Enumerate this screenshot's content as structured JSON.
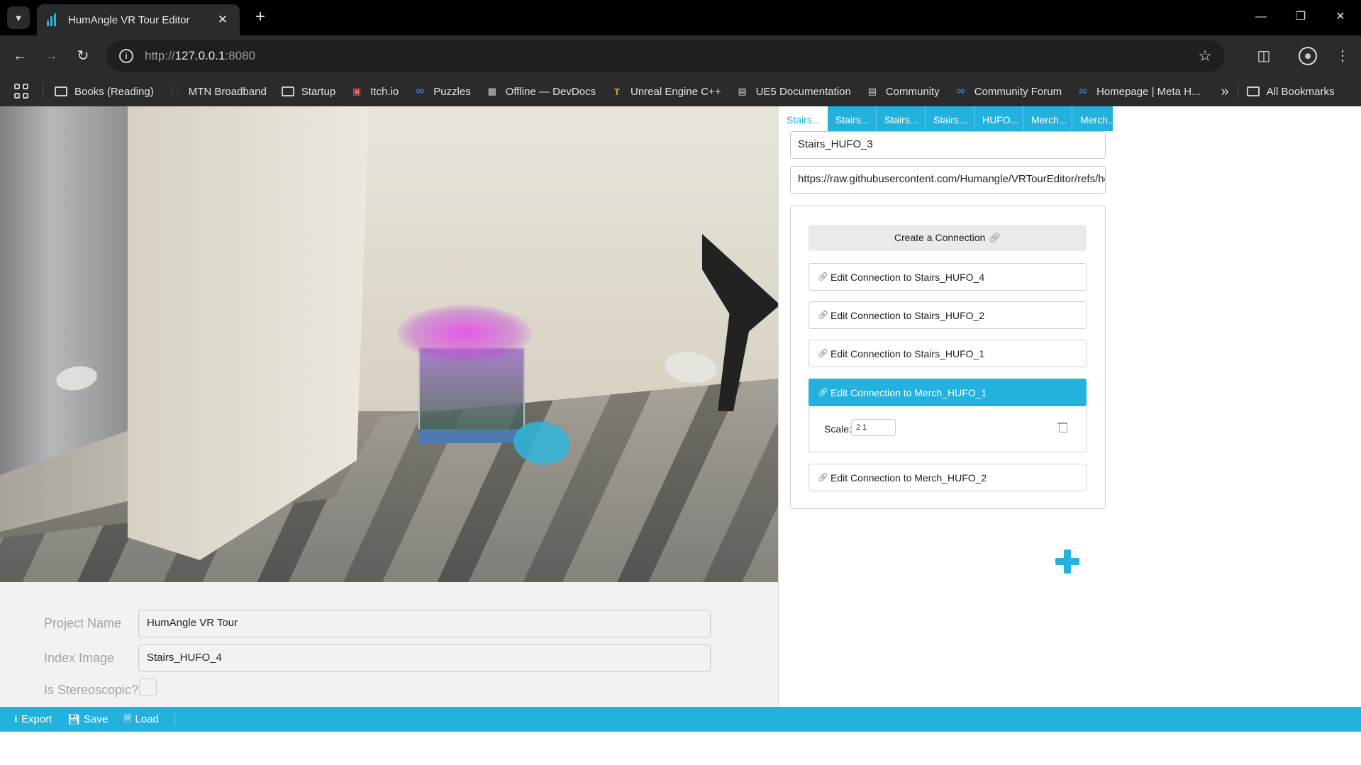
{
  "browser": {
    "tab_title": "HumAngle VR Tour Editor",
    "url_scheme": "http://",
    "url_host": "127.0.0.1",
    "url_port": ":8080",
    "bookmarks": [
      {
        "label": "Books (Reading)",
        "icon": "folder-icon"
      },
      {
        "label": "MTN Broadband",
        "icon": "globe-icon"
      },
      {
        "label": "Startup",
        "icon": "folder-icon"
      },
      {
        "label": "Itch.io",
        "icon": "itchio-icon"
      },
      {
        "label": "Puzzles",
        "icon": "meta-icon"
      },
      {
        "label": "Offline — DevDocs",
        "icon": "devdocs-icon"
      },
      {
        "label": "Unreal Engine C++",
        "icon": "unreal-icon"
      },
      {
        "label": "UE5 Documentation",
        "icon": "epic-icon"
      },
      {
        "label": "Community",
        "icon": "epic-icon"
      },
      {
        "label": "Community Forum",
        "icon": "meta-icon"
      },
      {
        "label": "Homepage | Meta H...",
        "icon": "meta-icon"
      }
    ],
    "all_bookmarks": "All Bookmarks"
  },
  "project": {
    "name_label": "Project Name",
    "name_value": "HumAngle VR Tour",
    "index_label": "Index Image",
    "index_value": "Stairs_HUFO_4",
    "stereo_label": "Is Stereoscopic?"
  },
  "statusbar": {
    "export": "Export",
    "save": "Save",
    "load": "Load"
  },
  "panel": {
    "tabs": [
      "Stairs...",
      "Stairs...",
      "Stairs...",
      "Stairs...",
      "HUFO...",
      "Merch...",
      "Merch..."
    ],
    "scene_name": "Stairs_HUFO_3",
    "scene_url": "https://raw.githubusercontent.com/Humangle/VRTourEditor/refs/heads/",
    "create_connection": "Create a Connection",
    "connections": [
      "Edit Connection to Stairs_HUFO_4",
      "Edit Connection to Stairs_HUFO_2",
      "Edit Connection to Stairs_HUFO_1",
      "Edit Connection to Merch_HUFO_1",
      "Edit Connection to Merch_HUFO_2"
    ],
    "scale_label": "Scale:",
    "scale_value": "2 1"
  },
  "colors": {
    "accent": "#23b1dd",
    "hotspot_idle": "#e8e6e2",
    "hotspot_active": "#2fb5d8"
  }
}
